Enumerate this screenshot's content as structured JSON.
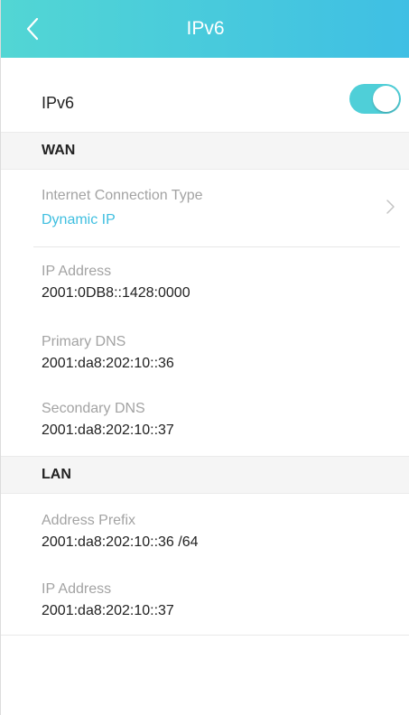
{
  "header": {
    "title": "IPv6",
    "back_icon": "chevron-left-icon"
  },
  "ipv6_toggle": {
    "label": "IPv6",
    "enabled": true,
    "accent_color": "#4fcfd8"
  },
  "wan": {
    "section_title": "WAN",
    "connection_type": {
      "label": "Internet Connection Type",
      "value": "Dynamic IP",
      "chevron_icon": "chevron-right-icon"
    },
    "ip_address": {
      "label": "IP Address",
      "value": "2001:0DB8::1428:0000"
    },
    "primary_dns": {
      "label": "Primary DNS",
      "value": "2001:da8:202:10::36"
    },
    "secondary_dns": {
      "label": "Secondary DNS",
      "value": "2001:da8:202:10::37"
    }
  },
  "lan": {
    "section_title": "LAN",
    "address_prefix": {
      "label": "Address Prefix",
      "value": "2001:da8:202:10::36 /64"
    },
    "ip_address": {
      "label": "IP Address",
      "value": "2001:da8:202:10::37"
    }
  },
  "colors": {
    "header_start": "#52d6d4",
    "header_end": "#3fbfe4",
    "accent_text": "#3fbfe0"
  }
}
